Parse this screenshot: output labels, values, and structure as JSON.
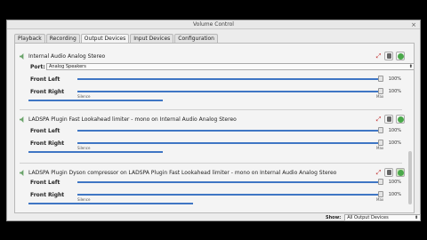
{
  "window": {
    "title": "Volume Control",
    "close_glyph": "×"
  },
  "tabs": [
    {
      "label": "Playback"
    },
    {
      "label": "Recording"
    },
    {
      "label": "Output Devices"
    },
    {
      "label": "Input Devices"
    },
    {
      "label": "Configuration"
    }
  ],
  "active_tab": 2,
  "devices": [
    {
      "name": "Internal Audio Analog Stereo",
      "port_label": "Port:",
      "port_value": "Analog Speakers",
      "channels": [
        {
          "label": "Front Left",
          "percent": "100%"
        },
        {
          "label": "Front Right",
          "percent": "100%"
        }
      ],
      "scale_silence": "Silence",
      "scale_max": "Max",
      "level": 0.36
    },
    {
      "name": "LADSPA Plugin Fast Lookahead limiter - mono on Internal Audio Analog Stereo",
      "channels": [
        {
          "label": "Front Left",
          "percent": "100%"
        },
        {
          "label": "Front Right",
          "percent": "100%"
        }
      ],
      "scale_silence": "Silence",
      "scale_max": "Max",
      "level": 0.36
    },
    {
      "name": "LADSPA Plugin Dyson compressor on LADSPA Plugin Fast Lookahead limiter - mono on Internal Audio Analog Stereo",
      "channels": [
        {
          "label": "Front Left",
          "percent": "100%"
        },
        {
          "label": "Front Right",
          "percent": "100%"
        }
      ],
      "scale_silence": "Silence",
      "scale_max": "Max",
      "level": 0.44
    }
  ],
  "footer": {
    "show_label": "Show:",
    "show_value": "All Output Devices",
    "arrow": "⬍"
  },
  "colors": {
    "accent": "#3f76c4",
    "default_ok": "#4aa84a",
    "lock": "#c03030"
  }
}
